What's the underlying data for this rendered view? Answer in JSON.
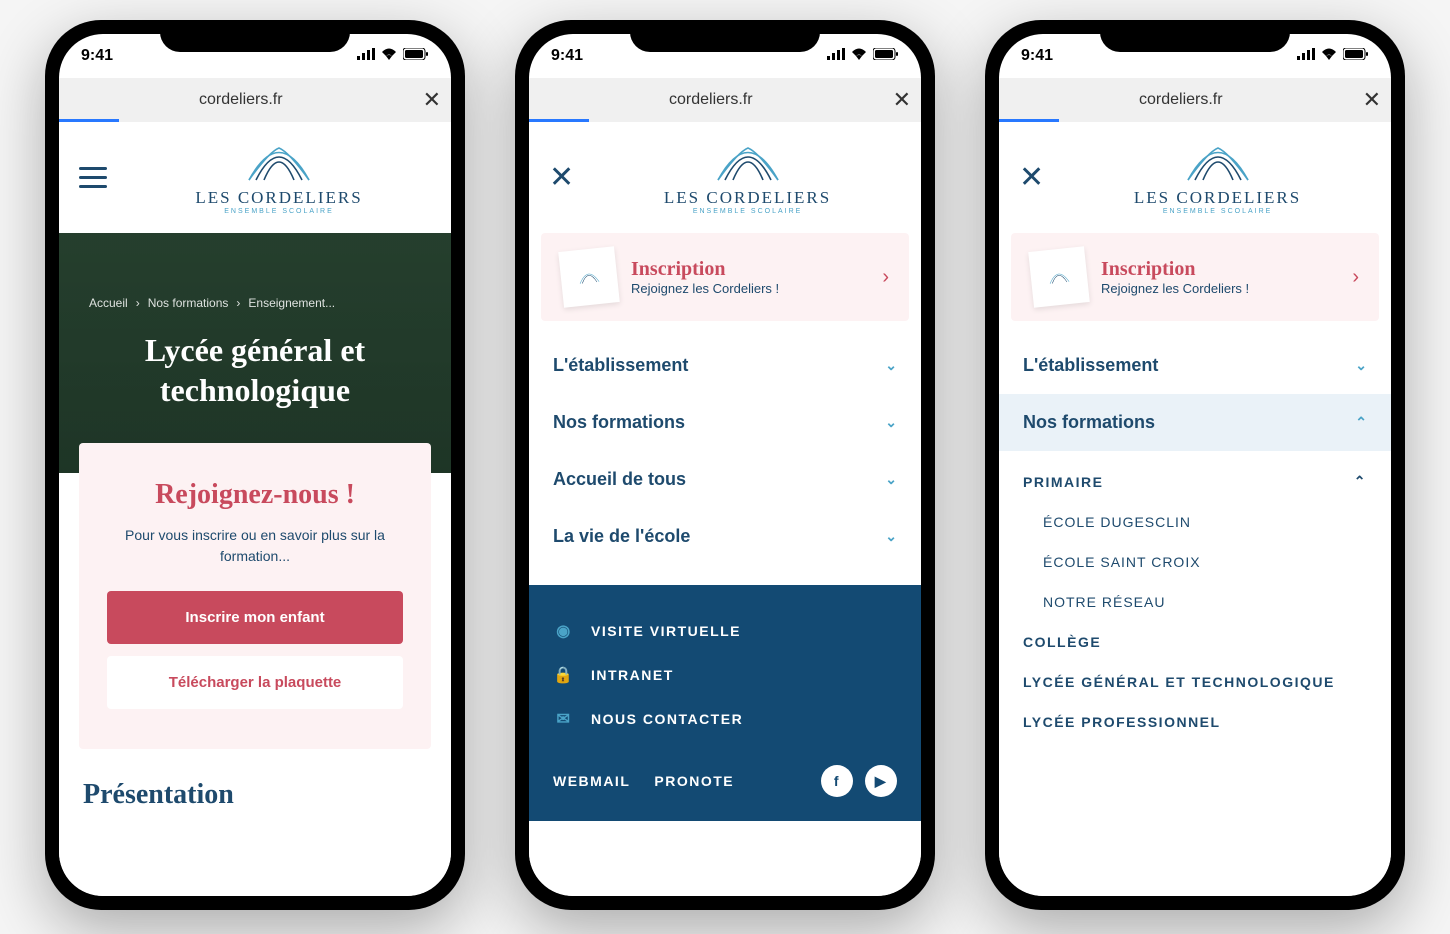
{
  "status": {
    "time": "9:41"
  },
  "browser": {
    "url": "cordeliers.fr"
  },
  "logo": {
    "name": "LES CORDELIERS",
    "tagline": "ENSEMBLE SCOLAIRE"
  },
  "screen1": {
    "breadcrumb": [
      "Accueil",
      "Nos formations",
      "Enseignement..."
    ],
    "hero_title": "Lycée général et technologique",
    "card": {
      "title": "Rejoignez-nous !",
      "text": "Pour vous inscrire ou en savoir plus sur la formation...",
      "primary": "Inscrire mon enfant",
      "secondary": "Télécharger la plaquette"
    },
    "section_heading": "Présentation"
  },
  "inscription": {
    "title": "Inscription",
    "subtitle": "Rejoignez les Cordeliers !"
  },
  "menu": {
    "items": [
      {
        "label": "L'établissement"
      },
      {
        "label": "Nos formations"
      },
      {
        "label": "Accueil de tous"
      },
      {
        "label": "La vie de l'école"
      }
    ]
  },
  "submenu": {
    "group_primaire": "PRIMAIRE",
    "links": [
      "ÉCOLE DUGESCLIN",
      "ÉCOLE SAINT CROIX",
      "NOTRE RÉSEAU"
    ],
    "group_college": "COLLÈGE",
    "group_lycee_gt": "LYCÉE GÉNÉRAL ET TECHNOLOGIQUE",
    "group_lycee_pro": "LYCÉE PROFESSIONNEL"
  },
  "footer": {
    "links": [
      "VISITE VIRTUELLE",
      "INTRANET",
      "NOUS CONTACTER"
    ],
    "bar": [
      "WEBMAIL",
      "PRONOTE"
    ]
  }
}
